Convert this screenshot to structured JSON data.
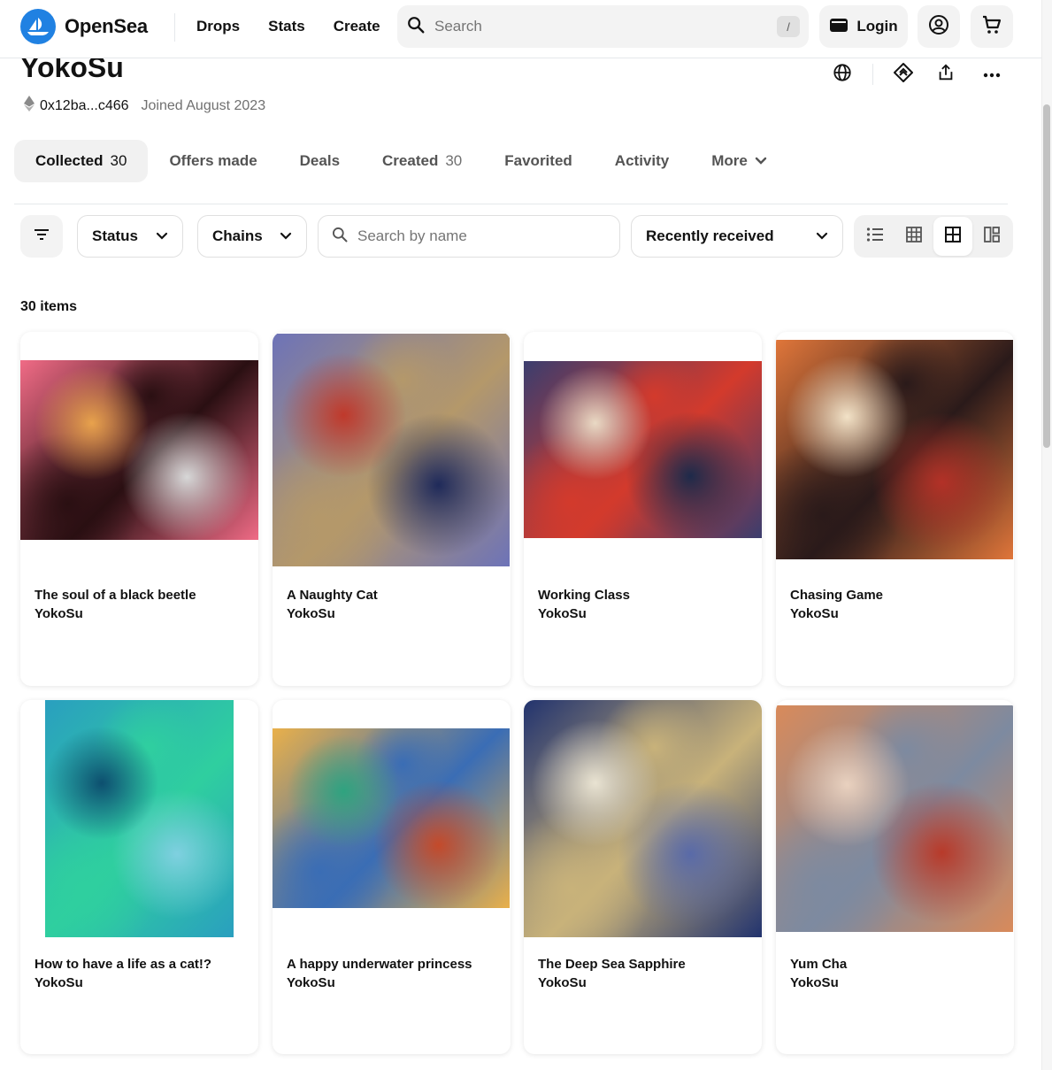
{
  "topnav": {
    "brand": "OpenSea",
    "links": [
      "Drops",
      "Stats",
      "Create"
    ],
    "search_placeholder": "Search",
    "search_shortcut": "/",
    "login_label": "Login"
  },
  "profile": {
    "name": "YokoSu",
    "address": "0x12ba...c466",
    "joined": "Joined August 2023"
  },
  "tabs": [
    {
      "label": "Collected",
      "count": "30"
    },
    {
      "label": "Offers made",
      "count": ""
    },
    {
      "label": "Deals",
      "count": ""
    },
    {
      "label": "Created",
      "count": "30"
    },
    {
      "label": "Favorited",
      "count": ""
    },
    {
      "label": "Activity",
      "count": ""
    },
    {
      "label": "More",
      "count": ""
    }
  ],
  "filters": {
    "status_label": "Status",
    "chains_label": "Chains",
    "name_search_placeholder": "Search by name",
    "sort_label": "Recently received"
  },
  "item_count": "30 items",
  "items": [
    {
      "title": "The soul of a black beetle",
      "creator": "YokoSu",
      "palette": [
        "#f06b86",
        "#2a0f12",
        "#e8a24c",
        "#d7d7d7"
      ]
    },
    {
      "title": "A Naughty Cat",
      "creator": "YokoSu",
      "palette": [
        "#6d73b8",
        "#b4986a",
        "#c0392b",
        "#1f2a5a"
      ]
    },
    {
      "title": "Working Class",
      "creator": "YokoSu",
      "palette": [
        "#3b3d6e",
        "#d33a2c",
        "#e9d9c4",
        "#1e2a4a"
      ]
    },
    {
      "title": "Chasing Game",
      "creator": "YokoSu",
      "palette": [
        "#e0763a",
        "#2a1a1a",
        "#f2e2c7",
        "#b33127"
      ]
    },
    {
      "title": "How to have a life as a cat!?",
      "creator": "YokoSu",
      "palette": [
        "#2a9fbf",
        "#2fcf9f",
        "#0d4f6f",
        "#7fd0e0"
      ]
    },
    {
      "title": "A happy underwater princess",
      "creator": "YokoSu",
      "palette": [
        "#e9b04a",
        "#3a6db5",
        "#2fa37f",
        "#c44a2a"
      ]
    },
    {
      "title": "The Deep Sea Sapphire",
      "creator": "YokoSu",
      "palette": [
        "#22336e",
        "#c8b27a",
        "#e9e3d2",
        "#596aa8"
      ]
    },
    {
      "title": "Yum Cha",
      "creator": "YokoSu",
      "palette": [
        "#d98a5a",
        "#7d8aa0",
        "#e9d1bf",
        "#b83a2a"
      ]
    }
  ]
}
